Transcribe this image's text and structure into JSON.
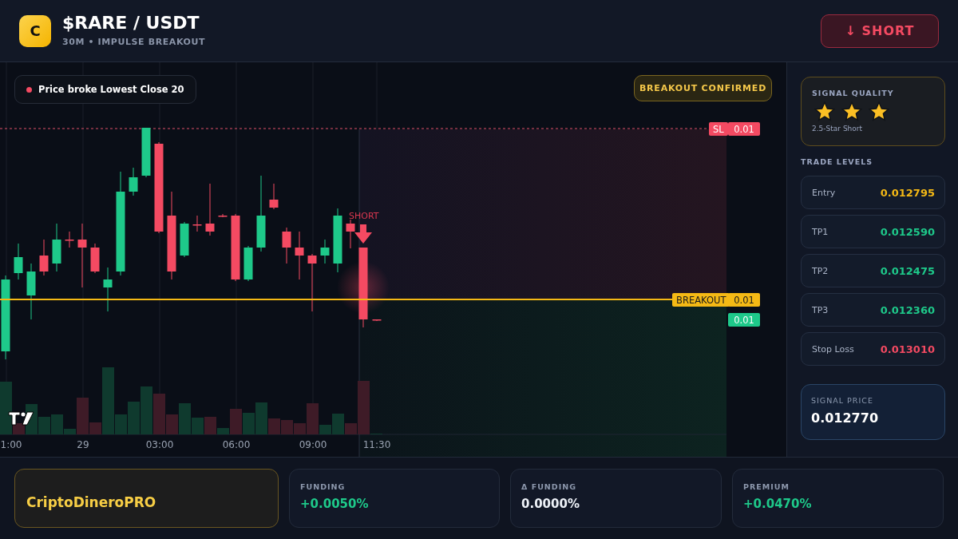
{
  "header": {
    "logo": "C",
    "title": "$RARE / USDT",
    "subtitle": "30M • IMPULSE BREAKOUT",
    "action": {
      "arrow": "↓",
      "label": "SHORT"
    }
  },
  "chart": {
    "alert": "Price broke Lowest Close 20",
    "status_badge": "BREAKOUT CONFIRMED",
    "signal_marker": "SHORT",
    "price_tags": [
      {
        "kind": "stop",
        "label": "SL",
        "value": "0.01"
      },
      {
        "kind": "breakout",
        "label": "BREAKOUT",
        "value": "0.01"
      },
      {
        "kind": "current",
        "value": "0.01"
      }
    ],
    "time_labels": [
      "1:00",
      "29",
      "03:00",
      "06:00",
      "09:00",
      "11:30"
    ]
  },
  "sidebar": {
    "quality": {
      "title": "SIGNAL QUALITY",
      "stars": 3,
      "caption": "2.5-Star Short"
    },
    "levels_title": "TRADE LEVELS",
    "levels": [
      {
        "kind": "entry",
        "label": "Entry",
        "value": "0.012795"
      },
      {
        "kind": "target",
        "label": "TP1",
        "value": "0.012590"
      },
      {
        "kind": "target",
        "label": "TP2",
        "value": "0.012475"
      },
      {
        "kind": "target",
        "label": "TP3",
        "value": "0.012360"
      },
      {
        "kind": "stop",
        "label": "Stop Loss",
        "value": "0.013010"
      }
    ],
    "signal_price": {
      "label": "SIGNAL PRICE",
      "value": "0.012770"
    }
  },
  "footer": {
    "brand": "CriptoDineroPRO",
    "stats": [
      {
        "kind": "positive",
        "label": "FUNDING",
        "value": "+0.0050%"
      },
      {
        "kind": "neutral",
        "label": "Δ FUNDING",
        "value": "0.0000%"
      },
      {
        "kind": "positive",
        "label": "PREMIUM",
        "value": "+0.0470%"
      }
    ]
  }
}
